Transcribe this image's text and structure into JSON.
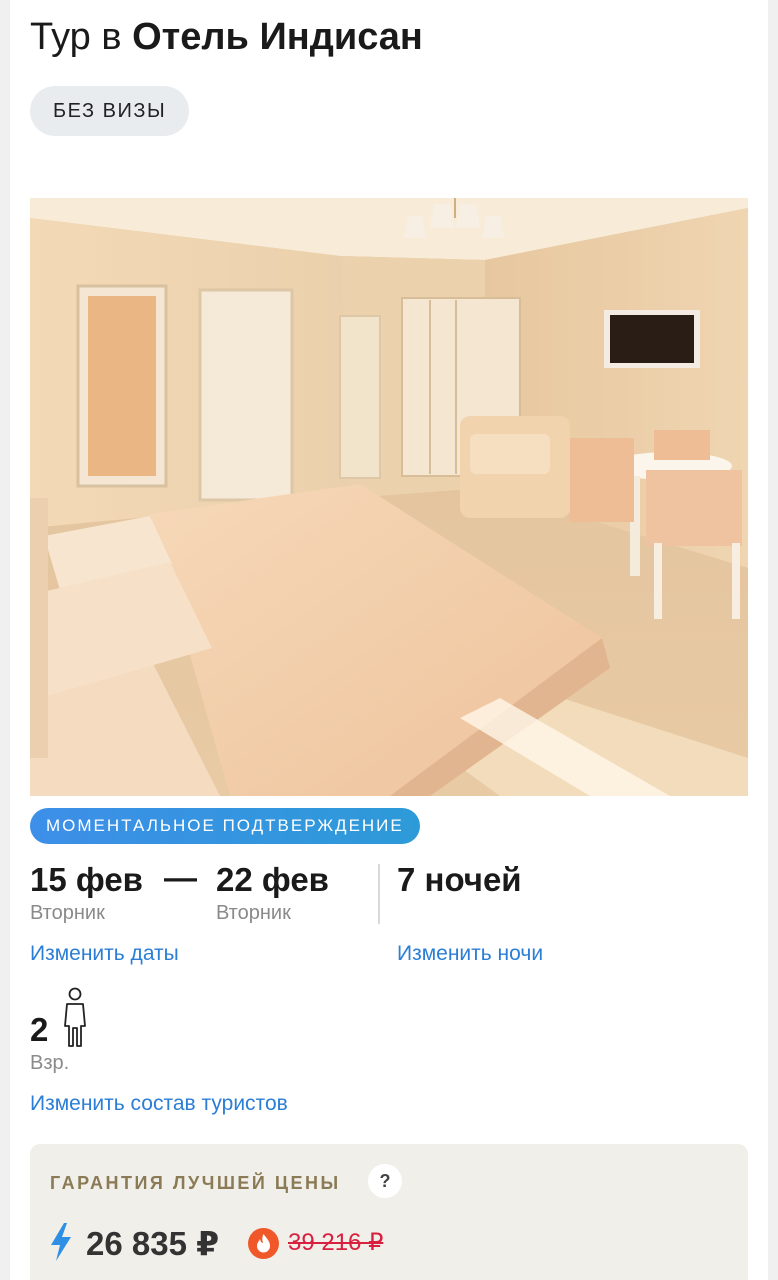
{
  "header": {
    "title_prefix": "Тур в",
    "title_hotel": "Отель Индисан"
  },
  "badges": {
    "visa": "БЕЗ ВИЗЫ",
    "confirmation": "МОМЕНТАЛЬНОЕ ПОДТВЕРЖДЕНИЕ"
  },
  "dates": {
    "from": "15 фев",
    "from_day": "Вторник",
    "separator": "—",
    "to": "22 фев",
    "to_day": "Вторник",
    "nights": "7 ночей",
    "change_dates_label": "Изменить даты",
    "change_nights_label": "Изменить ночи"
  },
  "tourists": {
    "count": "2",
    "type": "Взр.",
    "change_label": "Изменить состав туристов"
  },
  "price": {
    "guarantee_label": "ГАРАНТИЯ ЛУЧШЕЙ ЦЕНЫ",
    "help_label": "?",
    "current": "26 835 ₽",
    "old": "39 216 ₽"
  },
  "icons": {
    "map": "map-icon",
    "person": "person-icon",
    "bolt": "bolt-icon",
    "fire": "fire-icon"
  },
  "colors": {
    "link": "#2b7ed6",
    "confirm_badge": "#3d8fe8",
    "old_price": "#d8203f",
    "guarantee": "#8a7a55"
  }
}
